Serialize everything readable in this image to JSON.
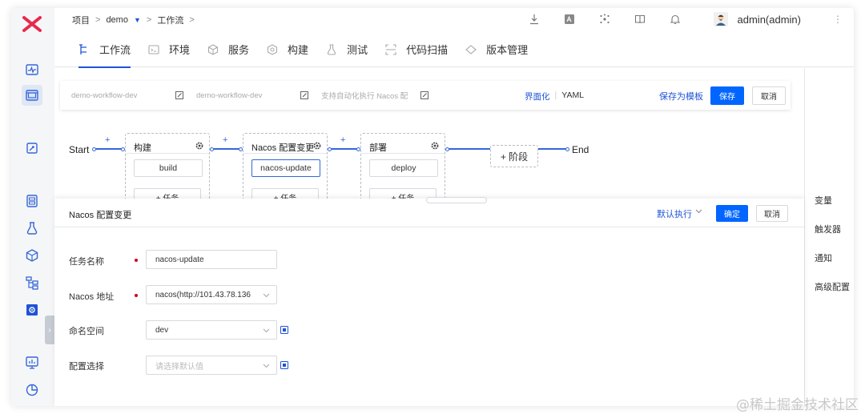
{
  "breadcrumb": {
    "project": "项目",
    "sep": ">",
    "name": "demo",
    "section": "工作流"
  },
  "header": {
    "user": "admin(admin)",
    "more": "⋮"
  },
  "tabs": [
    {
      "label": "工作流",
      "icon": "workflow-icon",
      "active": true
    },
    {
      "label": "环境",
      "icon": "env-icon"
    },
    {
      "label": "服务",
      "icon": "service-icon"
    },
    {
      "label": "构建",
      "icon": "build-icon"
    },
    {
      "label": "测试",
      "icon": "test-icon"
    },
    {
      "label": "代码扫描",
      "icon": "scan-icon"
    },
    {
      "label": "版本管理",
      "icon": "version-icon"
    }
  ],
  "config_bar": {
    "workflow_id": "demo-workflow-dev",
    "workflow_name": "demo-workflow-dev",
    "description": "支持自动化执行 Nacos 配",
    "mode_ui": "界面化",
    "mode_sep": "|",
    "mode_yaml": "YAML",
    "save_template": "保存为模板",
    "save": "保存",
    "cancel": "取消"
  },
  "flow": {
    "start": "Start",
    "end": "End",
    "plus": "+",
    "add_stage": "+ 阶段",
    "stages": [
      {
        "title": "构建",
        "job": "build",
        "add_task": "+ 任务"
      },
      {
        "title": "Nacos 配置变更",
        "job": "nacos-update",
        "add_task": "+ 任务"
      },
      {
        "title": "部署",
        "job": "deploy",
        "add_task": "+ 任务"
      }
    ]
  },
  "right_panel": {
    "items": [
      "变量",
      "触发器",
      "通知",
      "高级配置"
    ]
  },
  "drawer": {
    "title": "Nacos 配置变更",
    "run_mode": "默认执行",
    "confirm": "确定",
    "cancel": "取消",
    "fields": {
      "task_name_label": "任务名称",
      "task_name_value": "nacos-update",
      "nacos_addr_label": "Nacos 地址",
      "nacos_addr_value": "nacos(http://101.43.78.136",
      "namespace_label": "命名空间",
      "namespace_value": "dev",
      "config_label": "配置选择",
      "config_placeholder": "请选择默认值"
    }
  },
  "watermark": "@稀土掘金技术社区",
  "colors": {
    "accent": "#0066ff",
    "link": "#1f54d6",
    "brand": "#e8294c",
    "required": "#d0021b"
  }
}
